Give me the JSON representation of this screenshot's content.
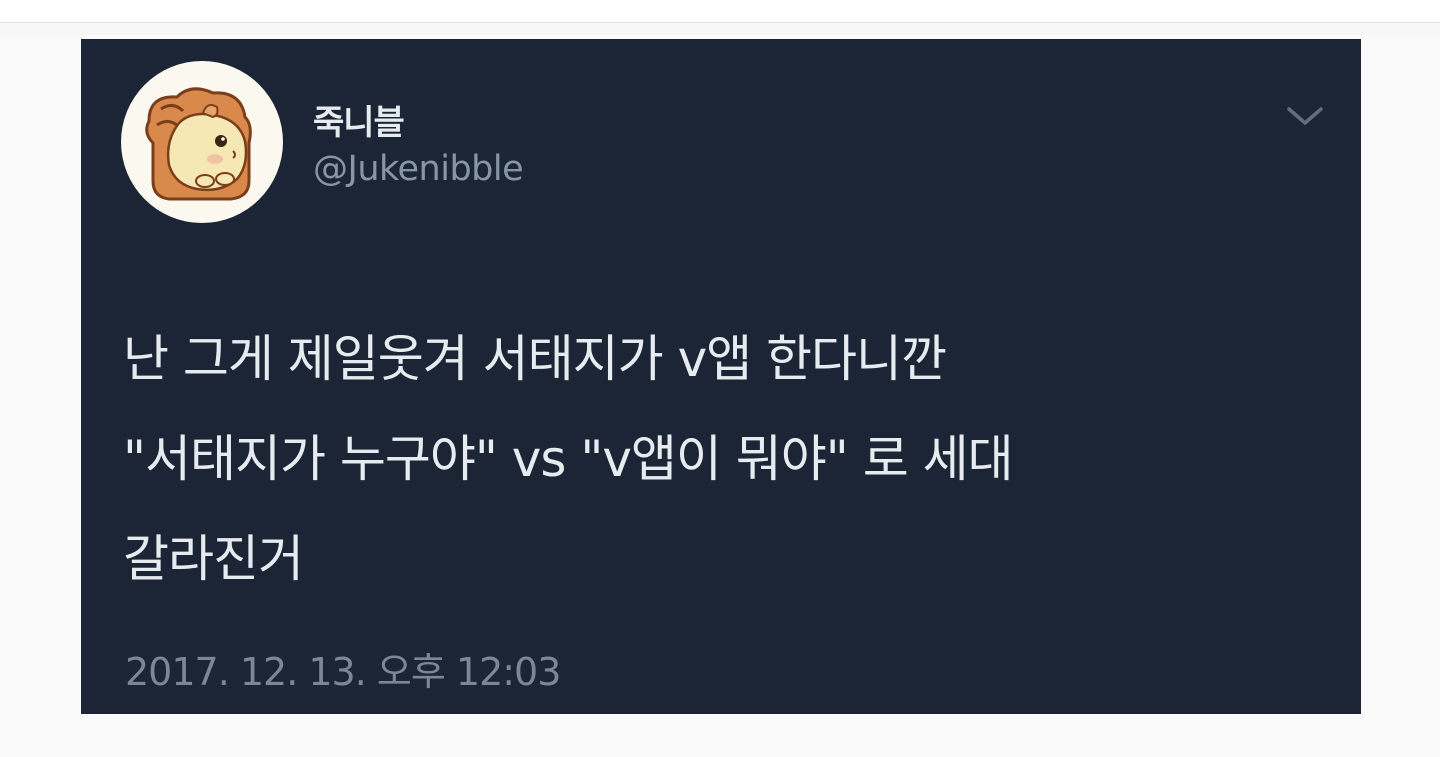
{
  "tweet": {
    "display_name": "죽니블",
    "handle": "@Jukenibble",
    "text": "난 그게 제일웃겨 서태지가 v앱 한다니깐\n\"서태지가 누구야\" vs \"v앱이 뭐야\" 로 세대\n갈라진거",
    "timestamp": "2017. 12. 13. 오후 12:03",
    "avatar_icon": "bread-hamster-avatar-icon",
    "menu_icon": "chevron-down-icon"
  },
  "colors": {
    "card_background": "#1b2535",
    "primary_text": "#e6ebf0",
    "secondary_text": "#8796a5",
    "page_background": "#fafafa"
  }
}
